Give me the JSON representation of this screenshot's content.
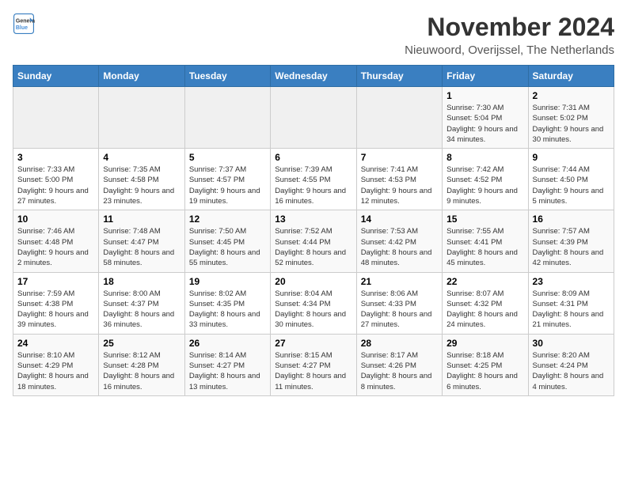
{
  "header": {
    "logo_line1": "General",
    "logo_line2": "Blue",
    "title": "November 2024",
    "subtitle": "Nieuwoord, Overijssel, The Netherlands"
  },
  "weekdays": [
    "Sunday",
    "Monday",
    "Tuesday",
    "Wednesday",
    "Thursday",
    "Friday",
    "Saturday"
  ],
  "weeks": [
    [
      {
        "day": "",
        "info": ""
      },
      {
        "day": "",
        "info": ""
      },
      {
        "day": "",
        "info": ""
      },
      {
        "day": "",
        "info": ""
      },
      {
        "day": "",
        "info": ""
      },
      {
        "day": "1",
        "info": "Sunrise: 7:30 AM\nSunset: 5:04 PM\nDaylight: 9 hours and 34 minutes."
      },
      {
        "day": "2",
        "info": "Sunrise: 7:31 AM\nSunset: 5:02 PM\nDaylight: 9 hours and 30 minutes."
      }
    ],
    [
      {
        "day": "3",
        "info": "Sunrise: 7:33 AM\nSunset: 5:00 PM\nDaylight: 9 hours and 27 minutes."
      },
      {
        "day": "4",
        "info": "Sunrise: 7:35 AM\nSunset: 4:58 PM\nDaylight: 9 hours and 23 minutes."
      },
      {
        "day": "5",
        "info": "Sunrise: 7:37 AM\nSunset: 4:57 PM\nDaylight: 9 hours and 19 minutes."
      },
      {
        "day": "6",
        "info": "Sunrise: 7:39 AM\nSunset: 4:55 PM\nDaylight: 9 hours and 16 minutes."
      },
      {
        "day": "7",
        "info": "Sunrise: 7:41 AM\nSunset: 4:53 PM\nDaylight: 9 hours and 12 minutes."
      },
      {
        "day": "8",
        "info": "Sunrise: 7:42 AM\nSunset: 4:52 PM\nDaylight: 9 hours and 9 minutes."
      },
      {
        "day": "9",
        "info": "Sunrise: 7:44 AM\nSunset: 4:50 PM\nDaylight: 9 hours and 5 minutes."
      }
    ],
    [
      {
        "day": "10",
        "info": "Sunrise: 7:46 AM\nSunset: 4:48 PM\nDaylight: 9 hours and 2 minutes."
      },
      {
        "day": "11",
        "info": "Sunrise: 7:48 AM\nSunset: 4:47 PM\nDaylight: 8 hours and 58 minutes."
      },
      {
        "day": "12",
        "info": "Sunrise: 7:50 AM\nSunset: 4:45 PM\nDaylight: 8 hours and 55 minutes."
      },
      {
        "day": "13",
        "info": "Sunrise: 7:52 AM\nSunset: 4:44 PM\nDaylight: 8 hours and 52 minutes."
      },
      {
        "day": "14",
        "info": "Sunrise: 7:53 AM\nSunset: 4:42 PM\nDaylight: 8 hours and 48 minutes."
      },
      {
        "day": "15",
        "info": "Sunrise: 7:55 AM\nSunset: 4:41 PM\nDaylight: 8 hours and 45 minutes."
      },
      {
        "day": "16",
        "info": "Sunrise: 7:57 AM\nSunset: 4:39 PM\nDaylight: 8 hours and 42 minutes."
      }
    ],
    [
      {
        "day": "17",
        "info": "Sunrise: 7:59 AM\nSunset: 4:38 PM\nDaylight: 8 hours and 39 minutes."
      },
      {
        "day": "18",
        "info": "Sunrise: 8:00 AM\nSunset: 4:37 PM\nDaylight: 8 hours and 36 minutes."
      },
      {
        "day": "19",
        "info": "Sunrise: 8:02 AM\nSunset: 4:35 PM\nDaylight: 8 hours and 33 minutes."
      },
      {
        "day": "20",
        "info": "Sunrise: 8:04 AM\nSunset: 4:34 PM\nDaylight: 8 hours and 30 minutes."
      },
      {
        "day": "21",
        "info": "Sunrise: 8:06 AM\nSunset: 4:33 PM\nDaylight: 8 hours and 27 minutes."
      },
      {
        "day": "22",
        "info": "Sunrise: 8:07 AM\nSunset: 4:32 PM\nDaylight: 8 hours and 24 minutes."
      },
      {
        "day": "23",
        "info": "Sunrise: 8:09 AM\nSunset: 4:31 PM\nDaylight: 8 hours and 21 minutes."
      }
    ],
    [
      {
        "day": "24",
        "info": "Sunrise: 8:10 AM\nSunset: 4:29 PM\nDaylight: 8 hours and 18 minutes."
      },
      {
        "day": "25",
        "info": "Sunrise: 8:12 AM\nSunset: 4:28 PM\nDaylight: 8 hours and 16 minutes."
      },
      {
        "day": "26",
        "info": "Sunrise: 8:14 AM\nSunset: 4:27 PM\nDaylight: 8 hours and 13 minutes."
      },
      {
        "day": "27",
        "info": "Sunrise: 8:15 AM\nSunset: 4:27 PM\nDaylight: 8 hours and 11 minutes."
      },
      {
        "day": "28",
        "info": "Sunrise: 8:17 AM\nSunset: 4:26 PM\nDaylight: 8 hours and 8 minutes."
      },
      {
        "day": "29",
        "info": "Sunrise: 8:18 AM\nSunset: 4:25 PM\nDaylight: 8 hours and 6 minutes."
      },
      {
        "day": "30",
        "info": "Sunrise: 8:20 AM\nSunset: 4:24 PM\nDaylight: 8 hours and 4 minutes."
      }
    ]
  ]
}
